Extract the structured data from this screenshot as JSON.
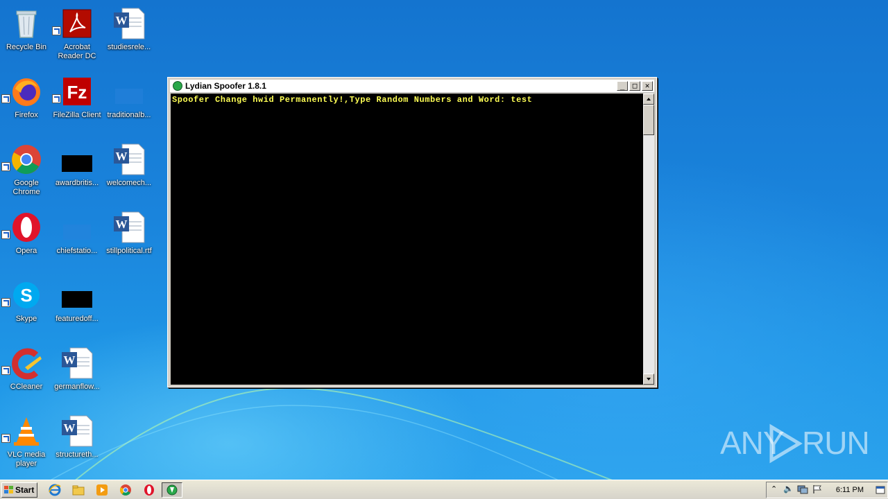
{
  "desktop": {
    "icons": [
      {
        "label": "Recycle Bin"
      },
      {
        "label": "Acrobat Reader DC"
      },
      {
        "label": "studiesrele..."
      },
      {
        "label": "Firefox"
      },
      {
        "label": "FileZilla Client"
      },
      {
        "label": "traditionalb..."
      },
      {
        "label": "Google Chrome"
      },
      {
        "label": "awardbritis..."
      },
      {
        "label": "welcomech..."
      },
      {
        "label": "Opera"
      },
      {
        "label": "chiefstatio..."
      },
      {
        "label": "stillpolitical.rtf"
      },
      {
        "label": "Skype"
      },
      {
        "label": "featuredoff..."
      },
      {
        "label": "CCleaner"
      },
      {
        "label": "germanflow..."
      },
      {
        "label": "VLC media player"
      },
      {
        "label": "structureth..."
      }
    ]
  },
  "console": {
    "title": "Lydian Spoofer 1.8.1",
    "line": "Spoofer Change hwid Permanently!,Type Random Numbers and Word: test",
    "text_color": "#ffff55",
    "minimize_label": "_",
    "maximize_label": "□",
    "close_label": "✕"
  },
  "watermark": {
    "left": "ANY",
    "right": "RUN"
  },
  "taskbar": {
    "start_label": "Start",
    "clock": "6:11 PM",
    "pinned": [
      "ie-icon",
      "explorer-icon",
      "media-player-icon",
      "chrome-icon",
      "opera-icon",
      "lydian-spoofer-icon"
    ]
  }
}
